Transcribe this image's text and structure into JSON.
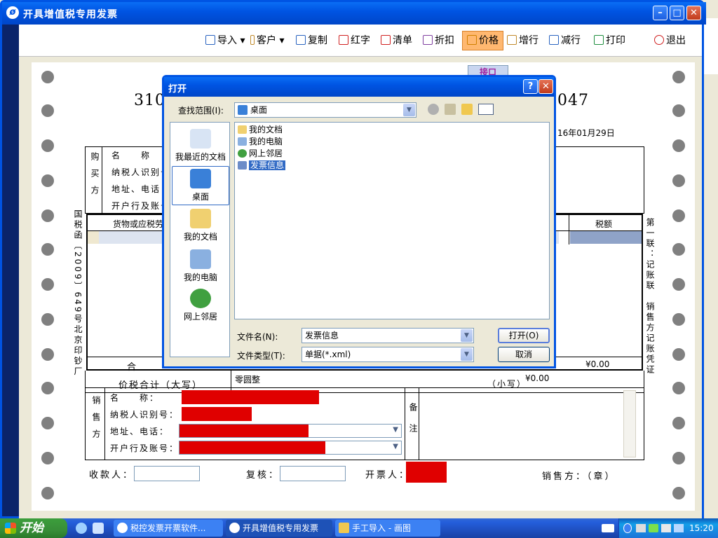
{
  "window": {
    "title": "开具增值税专用发票"
  },
  "toolbar": {
    "items": [
      {
        "label": "导入",
        "color": "#2b64c0"
      },
      {
        "label": "客户",
        "color": "#c08a2b"
      },
      {
        "label": "复制",
        "color": "#2b64c0"
      },
      {
        "label": "红字",
        "color": "#d02020"
      },
      {
        "label": "清单",
        "color": "#d02020"
      },
      {
        "label": "折扣",
        "color": "#8040a0"
      },
      {
        "label": "价格",
        "color": "#d08000"
      },
      {
        "label": "增行",
        "color": "#c08a2b"
      },
      {
        "label": "减行",
        "color": "#2b64c0"
      },
      {
        "label": "打印",
        "color": "#1f8f3f"
      },
      {
        "label": "退出",
        "color": "#d02020"
      }
    ]
  },
  "invoice": {
    "tab_label": "接口",
    "code_left": "310",
    "code_right": "047",
    "date": "16年01月29日",
    "buyer_side": "购买方",
    "buyer_fields": [
      "名　　称",
      "纳税人识别号",
      "地址、电话",
      "开户行及账号"
    ],
    "goods_header": "货物或应税劳",
    "tax_header": "税额",
    "total_label": "合",
    "total_tax": "¥0.00",
    "price_total_label": "价税合计（大写）",
    "price_total_upper": "零圆整",
    "small_label": "（小写）",
    "small_value": "¥0.00",
    "seller_side": "销售方",
    "seller_fields": [
      "名　　称：",
      "纳税人识别号：",
      "地址、电话：",
      "开户行及账号："
    ],
    "remarks": "备注",
    "left_vertical": "国税函〔2009〕649号北京印钞厂",
    "right_vertical": "第一联：记账联　销售方记账凭证",
    "payee": "收款人：",
    "reviewer": "复核：",
    "issuer": "开票人：",
    "seller_stamp": "销售方：（章）"
  },
  "dialog": {
    "title": "打开",
    "look_in_label": "查找范围(I):",
    "look_in_value": "桌面",
    "places": [
      "我最近的文档",
      "桌面",
      "我的文档",
      "我的电脑",
      "网上邻居"
    ],
    "files": [
      "我的文档",
      "我的电脑",
      "网上邻居",
      "发票信息"
    ],
    "filename_label": "文件名(N):",
    "filename_value": "发票信息",
    "filetype_label": "文件类型(T):",
    "filetype_value": "单据(*.xml)",
    "open_button": "打开(O)",
    "cancel_button": "取消"
  },
  "taskbar": {
    "start": "开始",
    "tasks": [
      "税控发票开票软件...",
      "开具增值税专用发票",
      "手工导入 - 画图"
    ],
    "clock": "15:20"
  },
  "background": {
    "left_fragment": "310"
  }
}
